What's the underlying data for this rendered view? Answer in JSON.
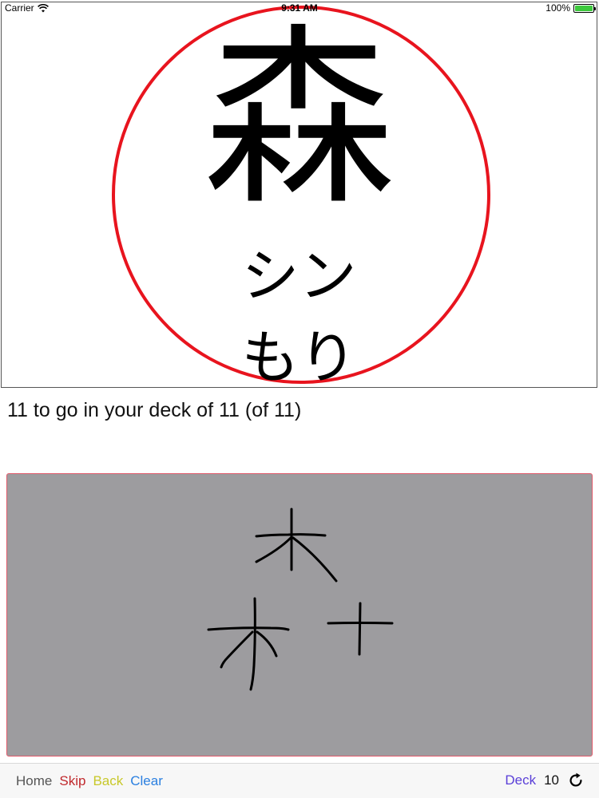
{
  "status_bar": {
    "carrier": "Carrier",
    "time": "9:31 AM",
    "battery": "100%"
  },
  "card": {
    "kanji": "森",
    "onyomi": "シン",
    "kunyomi": "もり",
    "circle_color": "#e8141e"
  },
  "progress": {
    "text": "11 to go in your deck of 11 (of 11)"
  },
  "drawing": {
    "background": "#9d9c9f"
  },
  "toolbar": {
    "home": "Home",
    "skip": "Skip",
    "back": "Back",
    "clear": "Clear",
    "deck": "Deck",
    "deck_count": "10"
  },
  "icons": {
    "wifi": "wifi-icon",
    "battery": "battery-icon",
    "refresh": "refresh-icon"
  }
}
